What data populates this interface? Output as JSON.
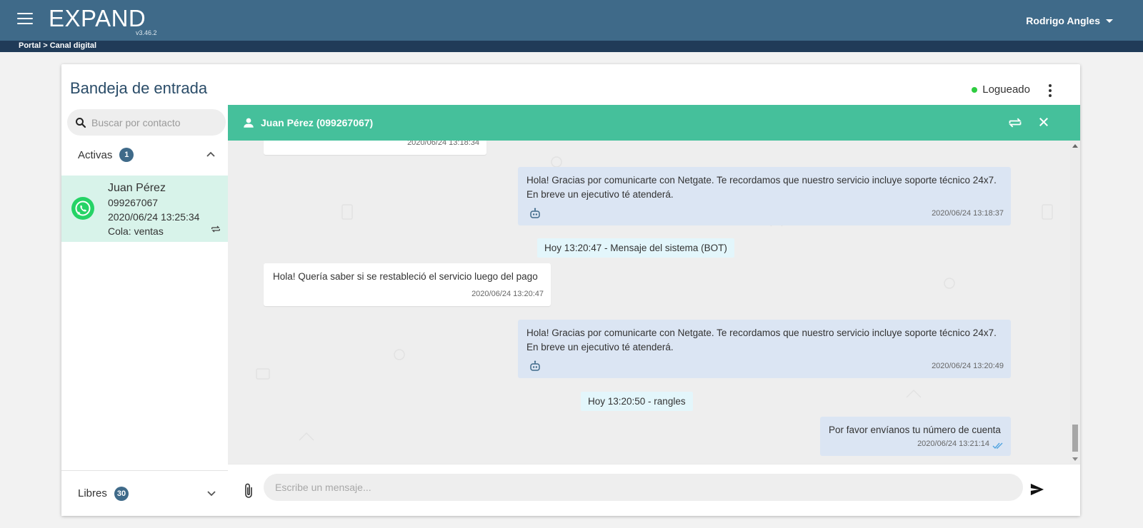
{
  "header": {
    "logo_text": "EXPAND",
    "version": "v3.46.2",
    "user_name": "Rodrigo Angles"
  },
  "breadcrumb": "Portal > Canal digital",
  "page": {
    "title": "Bandeja de entrada",
    "status": "Logueado"
  },
  "sidebar": {
    "search_placeholder": "Buscar por contacto",
    "activas_label": "Activas",
    "activas_count": "1",
    "libres_label": "Libres",
    "libres_count": "30",
    "contact": {
      "name": "Juan Pérez",
      "phone": "099267067",
      "datetime": "2020/06/24 13:25:34",
      "queue": "Cola: ventas"
    }
  },
  "chat": {
    "header_title": "Juan Pérez (099267067)",
    "messages": [
      {
        "type": "in",
        "text": "",
        "time": "2020/06/24 13:18:34"
      },
      {
        "type": "out",
        "line1": "Hola! Gracias por comunicarte con Netgate. Te recordamos que nuestro servicio incluye soporte técnico 24x7.",
        "line2": "En breve un ejecutivo té atenderá.",
        "time": "2020/06/24 13:18:37"
      },
      {
        "type": "system",
        "text": "Hoy 13:20:47 - Mensaje del sistema (BOT)"
      },
      {
        "type": "in",
        "text": "Hola! Quería saber si se restableció el servicio luego del pago",
        "time": "2020/06/24 13:20:47"
      },
      {
        "type": "out",
        "line1": "Hola! Gracias por comunicarte con Netgate. Te recordamos que nuestro servicio incluye soporte técnico 24x7.",
        "line2": "En breve un ejecutivo té atenderá.",
        "time": "2020/06/24 13:20:49"
      },
      {
        "type": "system",
        "text": "Hoy 13:20:50 - rangles"
      },
      {
        "type": "out",
        "text": "Por favor envíanos tu número de cuenta",
        "time": "2020/06/24 13:21:14"
      }
    ],
    "composer_placeholder": "Escribe un mensaje..."
  },
  "colors": {
    "topbar": "#3f6a89",
    "breadcrumb_bar": "#203b58",
    "chat_header": "#45c09b",
    "active_contact": "#d8f3ea",
    "status_online": "#2ecc40"
  }
}
